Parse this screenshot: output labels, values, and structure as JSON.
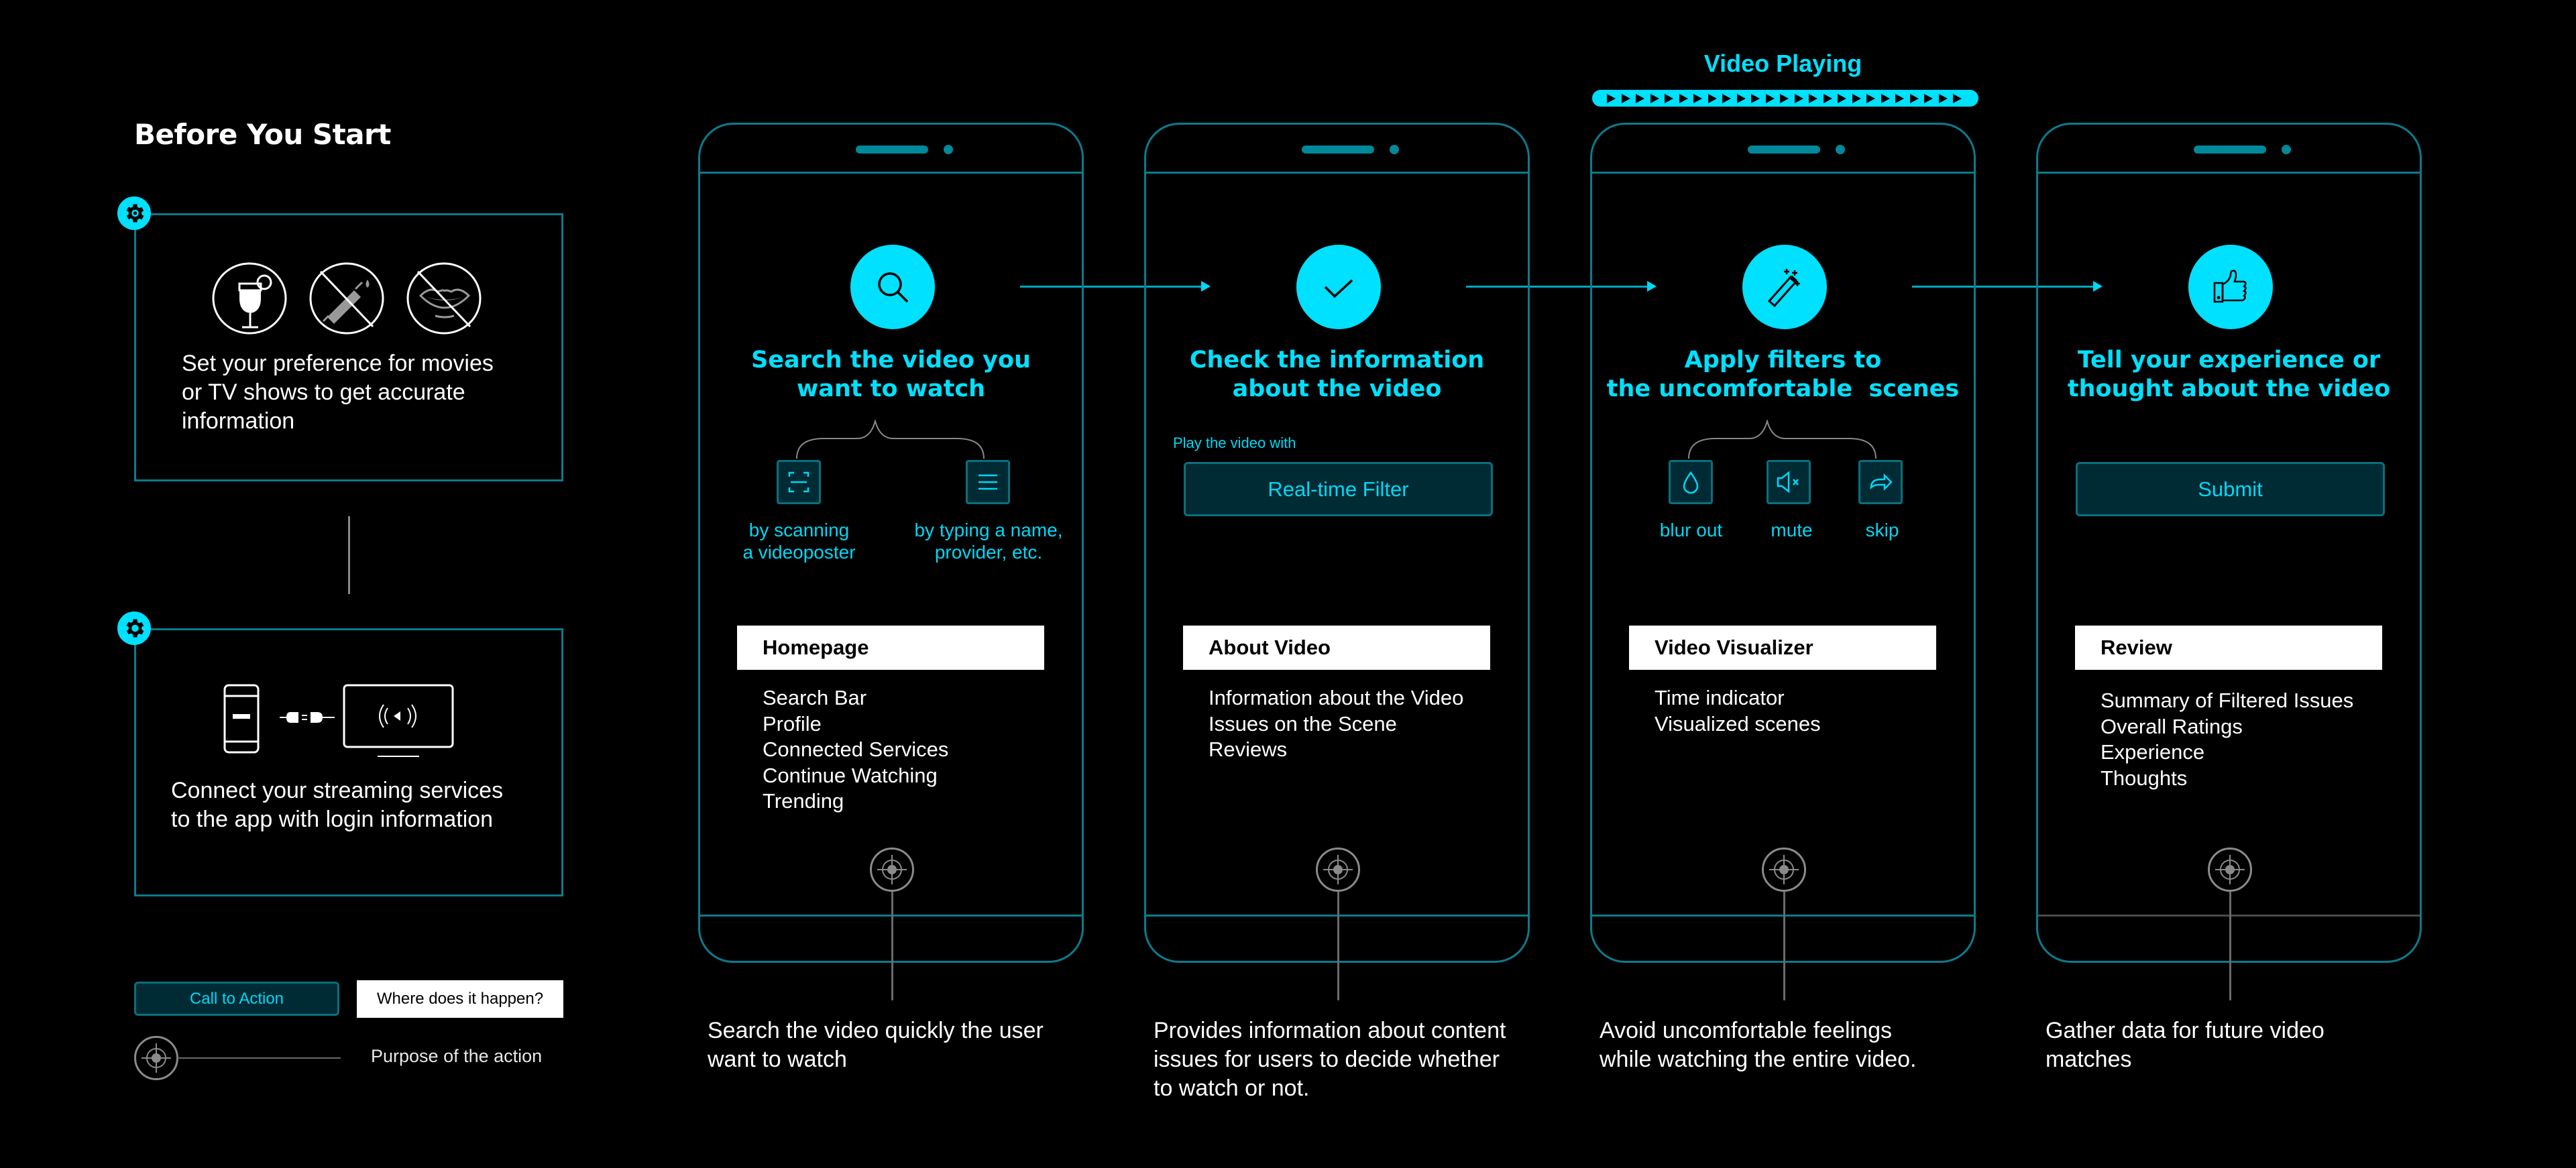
{
  "before_you_start": {
    "title": "Before You Start",
    "steps": [
      {
        "icon": "gear-icon",
        "illustrations": [
          "alcohol-icon",
          "no-drugs-icon",
          "no-kissing-icon"
        ],
        "text_lines": [
          "Set your preference for movies",
          "or TV shows to get accurate",
          "information"
        ]
      },
      {
        "icon": "gear-icon",
        "illustrations": [
          "phone-icon",
          "plug-icon",
          "tv-stream-icon"
        ],
        "text_lines": [
          "Connect your streaming services",
          "to the app with login information"
        ]
      }
    ]
  },
  "legend": {
    "call_to_action": "Call to Action",
    "where_does_it_happen": "Where does it happen?",
    "purpose": "Purpose of the action"
  },
  "video_playing": {
    "label": "Video Playing",
    "arrow_count": 25
  },
  "colors": {
    "accent": "#00e0ff",
    "frame": "#0a7b8c",
    "button_bg": "#002b35",
    "background": "#000000"
  },
  "phones": [
    {
      "icon": "search-icon",
      "title_lines": [
        "Search the video you",
        "want to watch"
      ],
      "options": [
        {
          "icon": "scan-icon",
          "label_lines": [
            "by scanning",
            "a videoposter"
          ]
        },
        {
          "icon": "menu-lines-icon",
          "label_lines": [
            "by typing a name,",
            "provider, etc."
          ]
        }
      ],
      "screen": "Homepage",
      "items": [
        "Search Bar",
        "Profile",
        "Connected Services",
        "Continue Watching",
        "Trending"
      ],
      "purpose_lines": [
        "Search the video quickly the user",
        "want to watch"
      ]
    },
    {
      "icon": "checkmark-icon",
      "title_lines": [
        "Check the information",
        "about the video"
      ],
      "action_caption": "Play the video with",
      "action_button": "Real-time Filter",
      "screen": "About Video",
      "items": [
        "Information about the Video",
        "Issues on the Scene",
        "Reviews"
      ],
      "purpose_lines": [
        "Provides information about content",
        "issues for users to decide whether",
        "to watch or not."
      ]
    },
    {
      "icon": "magic-wand-icon",
      "title_lines": [
        "Apply filters to",
        "the uncomfortable  scenes"
      ],
      "options": [
        {
          "icon": "drop-icon",
          "label_lines": [
            "blur out"
          ]
        },
        {
          "icon": "mute-icon",
          "label_lines": [
            "mute"
          ]
        },
        {
          "icon": "skip-arrow-icon",
          "label_lines": [
            "skip"
          ]
        }
      ],
      "screen": "Video Visualizer",
      "items": [
        "Time indicator",
        "Visualized scenes"
      ],
      "purpose_lines": [
        "Avoid uncomfortable feelings",
        "while watching the entire video."
      ]
    },
    {
      "icon": "thumbs-up-icon",
      "title_lines": [
        "Tell your experience or",
        "thought about the video"
      ],
      "action_button": "Submit",
      "screen": "Review",
      "items": [
        "Summary of Filtered Issues",
        "Overall Ratings",
        "Experience",
        "Thoughts"
      ],
      "purpose_lines": [
        "Gather data for future video",
        "matches"
      ]
    }
  ]
}
